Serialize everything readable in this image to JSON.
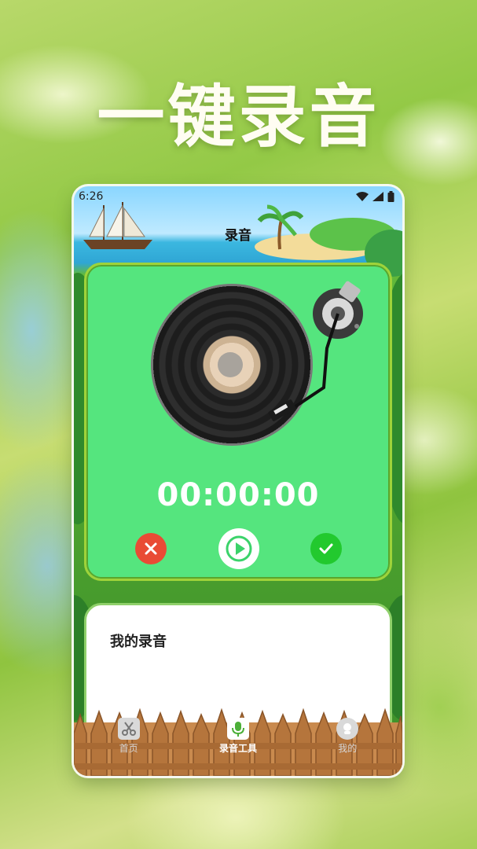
{
  "promo": {
    "headline": "一键录音"
  },
  "status_bar": {
    "time": "6:26"
  },
  "header": {
    "title": "录音"
  },
  "recorder": {
    "timer": "00:00:00",
    "controls": [
      "cancel",
      "play",
      "confirm"
    ]
  },
  "recordings": {
    "title": "我的录音"
  },
  "tabs": [
    {
      "label": "首页",
      "icon": "scissors-icon",
      "active": false
    },
    {
      "label": "录音工具",
      "icon": "microphone-icon",
      "active": true
    },
    {
      "label": "我的",
      "icon": "profile-icon",
      "active": false
    }
  ],
  "colors": {
    "card_green": "#55e57e",
    "cancel_red": "#e94b35",
    "confirm_green": "#22c92e",
    "fence_wood": "#c98a4e"
  }
}
